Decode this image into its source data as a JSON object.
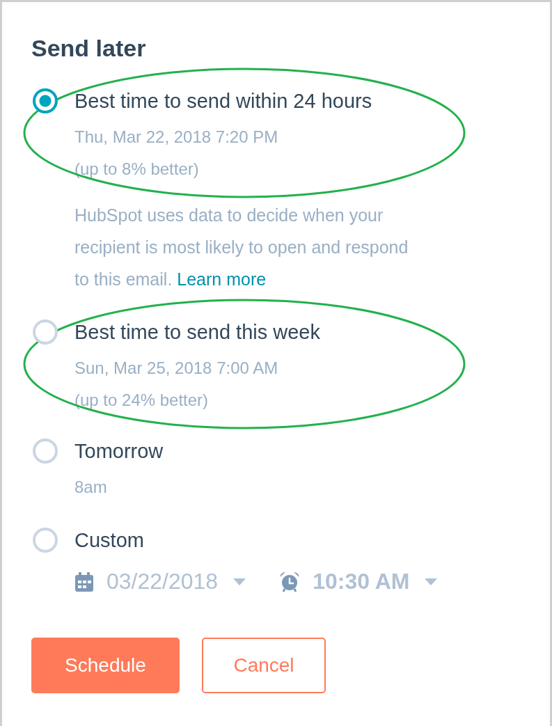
{
  "title": "Send later",
  "options": [
    {
      "label": "Best time to send within 24 hours",
      "selected": true,
      "highlighted": true,
      "details": [
        "Thu, Mar 22, 2018 7:20 PM",
        "(up to 8% better)"
      ],
      "description": "HubSpot uses data to decide when your recipient is most likely to open and respond to this email.",
      "link": "Learn more"
    },
    {
      "label": "Best time to send this week",
      "selected": false,
      "highlighted": true,
      "details": [
        "Sun, Mar 25, 2018 7:00 AM",
        "(up to 24% better)"
      ]
    },
    {
      "label": "Tomorrow",
      "selected": false,
      "highlighted": false,
      "details": [
        "8am"
      ]
    },
    {
      "label": "Custom",
      "selected": false,
      "highlighted": false,
      "date": "03/22/2018",
      "time": "10:30 AM"
    }
  ],
  "buttons": [
    {
      "label": "Schedule",
      "kind": "primary"
    },
    {
      "label": "Cancel",
      "kind": "secondary"
    }
  ]
}
